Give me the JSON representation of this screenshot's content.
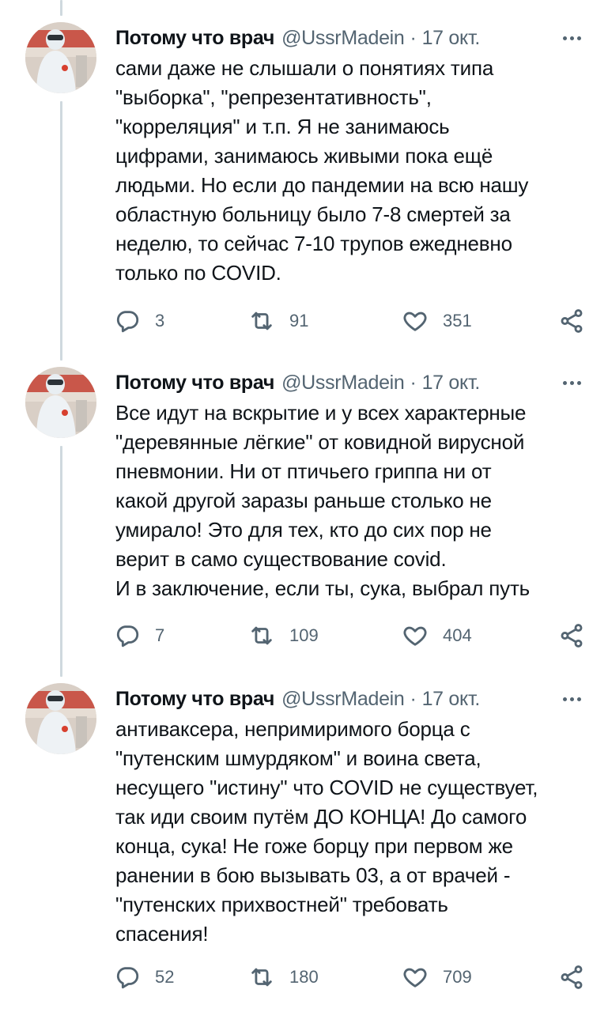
{
  "tweets": [
    {
      "name": "Потому что врач",
      "handle": "@UssrMadein",
      "separator": "·",
      "date": "17 окт.",
      "text": "сами даже не слышали о понятиях типа\n\"выборка\", \"репрезентативность\",\n\"корреляция\" и т.п. Я не занимаюсь\nцифрами, занимаюсь живыми пока ещё\nлюдьми. Но если до пандемии на всю нашу\nобластную больницу было 7-8 смертей за\nнеделю, то сейчас 7-10 трупов ежедневно\nтолько по COVID.",
      "replies": "3",
      "retweets": "91",
      "likes": "351"
    },
    {
      "name": "Потому что врач",
      "handle": "@UssrMadein",
      "separator": "·",
      "date": "17 окт.",
      "text": "Все идут на вскрытие и у всех характерные\n\"деревянные лёгкие\" от ковидной вирусной\nпневмонии. Ни от птичьего гриппа ни от\nкакой другой заразы раньше столько не\nумирало! Это для тех, кто до сих пор не\nверит в само существование covid.\nИ в заключение, если ты, сука, выбрал путь",
      "replies": "7",
      "retweets": "109",
      "likes": "404"
    },
    {
      "name": "Потому что врач",
      "handle": "@UssrMadein",
      "separator": "·",
      "date": "17 окт.",
      "text": "антиваксера, непримиримого борца с\n\"путенским шмурдяком\" и воина света,\nнесущего \"истину\" что COVID не существует,\nтак иди своим путём ДО КОНЦА! До самого\nконца, сука! Не гоже борцу при первом же\nранении в бою вызывать 03, а от врачей -\n\"путенских прихвостней\" требовать\nспасения!",
      "replies": "52",
      "retweets": "180",
      "likes": "709"
    }
  ],
  "icons": {
    "reply": "reply-icon",
    "retweet": "retweet-icon",
    "like": "heart-icon",
    "share": "share-icon",
    "more": "more-icon",
    "avatar": "avatar"
  },
  "colors": {
    "text": "#0f1419",
    "secondary": "#536471",
    "thread_line": "#cfd9de",
    "background": "#ffffff"
  }
}
